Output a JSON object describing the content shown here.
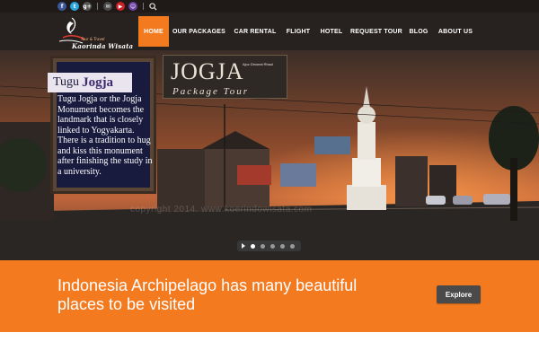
{
  "topbar": {
    "social_icons": [
      {
        "name": "facebook-icon",
        "glyph": "f",
        "color": "#3b5998"
      },
      {
        "name": "twitter-icon",
        "glyph": "t",
        "color": "#2aa4dd"
      },
      {
        "name": "google-plus-icon",
        "glyph": "g+",
        "color": "#555555"
      },
      {
        "name": "mail-icon",
        "glyph": "✉",
        "color": "#4a4a4a"
      },
      {
        "name": "youtube-icon",
        "glyph": "▶",
        "color": "#cc2127"
      },
      {
        "name": "yahoo-messenger-icon",
        "glyph": "☺",
        "color": "#6b3fa0"
      }
    ],
    "search_icon": "search-icon"
  },
  "header": {
    "logo_tagline": "Tour & Travel",
    "logo_name": "Kaorinda Wisata"
  },
  "nav": {
    "items": [
      {
        "label": "HOME",
        "active": true
      },
      {
        "label": "OUR PACKAGES",
        "active": false
      },
      {
        "label": "CAR RENTAL",
        "active": false
      },
      {
        "label": "FLIGHT",
        "active": false
      },
      {
        "label": "HOTEL",
        "active": false
      },
      {
        "label": "REQUEST TOUR",
        "active": false
      },
      {
        "label": "BLOG",
        "active": false
      },
      {
        "label": "ABOUT US",
        "active": false
      }
    ],
    "active_color": "#f47a20"
  },
  "hero": {
    "board_title_1": "Tugu",
    "board_title_2": "Jogja",
    "board_text": "Tugu Jogja or the Jogja Monument becomes the landmark that is closely linked to Yogyakarta. There is a tradition to hug and kiss this monument after finishing the study in a university.",
    "sign_big": "JOGJA",
    "sign_small": "Ajoc Dinoeal Rhaul",
    "sign_sub": "Package Tour",
    "watermark": "copyright 2014. www.koerindowisata.com",
    "slides_total": 5,
    "active_slide": 1
  },
  "banner": {
    "text": "Indonesia Archipelago has many beautiful places to be visited",
    "button_label": "Explore",
    "color": "#f47a20"
  }
}
